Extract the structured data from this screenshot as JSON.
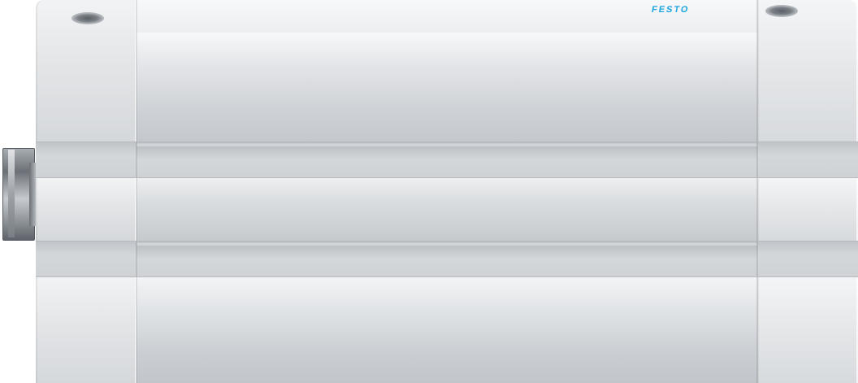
{
  "image": {
    "subject": "compact-pneumatic-cylinder",
    "logo_text": "FESTO",
    "colors": {
      "background": "#ffffff",
      "aluminium_light": "#f2f3f4",
      "aluminium_mid": "#d5d8db",
      "aluminium_dark": "#bfc3c7",
      "logo_blue": "#1ba4e0",
      "fitting_dark": "#5e6369"
    }
  }
}
